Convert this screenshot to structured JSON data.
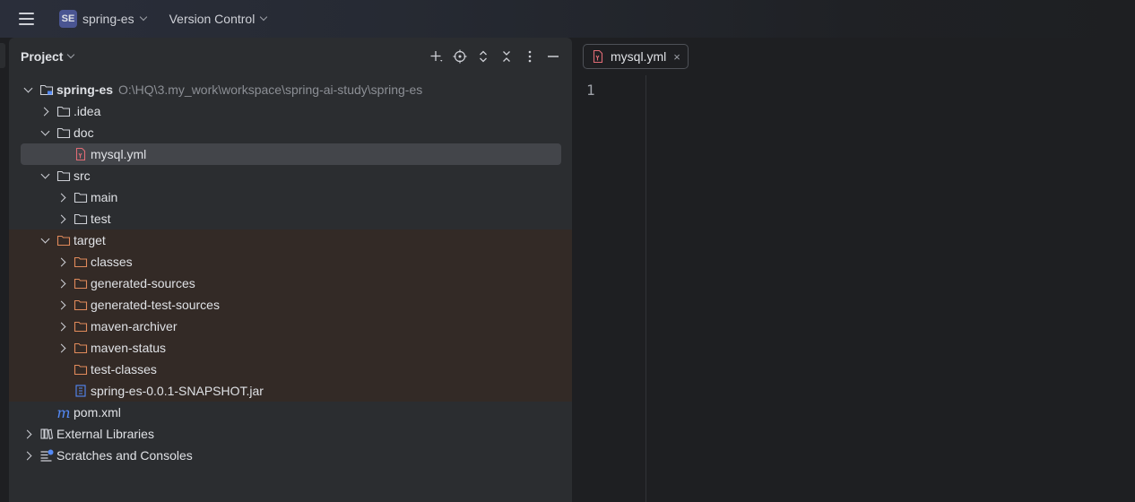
{
  "topbar": {
    "project_badge": "SE",
    "project_name": "spring-es",
    "vcs_label": "Version Control"
  },
  "project_panel": {
    "title": "Project",
    "actions": [
      "add-icon",
      "locate-icon",
      "expand-all-icon",
      "collapse-all-icon",
      "more-icon",
      "hide-icon"
    ]
  },
  "tree": {
    "root": {
      "name": "spring-es",
      "path": "O:\\HQ\\3.my_work\\workspace\\spring-ai-study\\spring-es"
    },
    "idea": ".idea",
    "doc": "doc",
    "mysql": "mysql.yml",
    "src": "src",
    "main": "main",
    "test": "test",
    "target": "target",
    "classes": "classes",
    "generated_sources": "generated-sources",
    "generated_test_sources": "generated-test-sources",
    "maven_archiver": "maven-archiver",
    "maven_status": "maven-status",
    "test_classes": "test-classes",
    "jar": "spring-es-0.0.1-SNAPSHOT.jar",
    "pom": "pom.xml",
    "external_libraries": "External Libraries",
    "scratches": "Scratches and Consoles"
  },
  "editor": {
    "tab_label": "mysql.yml",
    "close_glyph": "×",
    "line_number": "1"
  },
  "colors": {
    "folder": "#ced0d6",
    "excluded_folder": "#e08a5b",
    "yml_icon": "#e06c75",
    "maven_icon": "#548af7",
    "selection": "#43454a",
    "excluded_bg": "#332a26"
  }
}
